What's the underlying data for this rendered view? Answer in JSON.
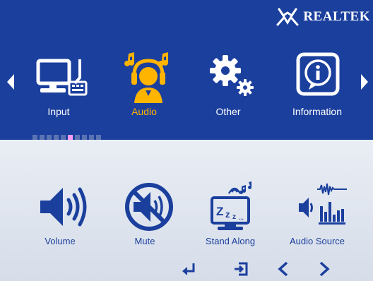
{
  "brand": {
    "name": "REALTEK"
  },
  "menu": {
    "items": [
      {
        "label": "Input",
        "icon": "computer-icon"
      },
      {
        "label": "Audio",
        "icon": "headphones-user-icon",
        "active": true
      },
      {
        "label": "Other",
        "icon": "gears-icon"
      },
      {
        "label": "Information",
        "icon": "info-icon"
      }
    ],
    "page_dots": 10,
    "active_dot": 6
  },
  "submenu": {
    "items": [
      {
        "label": "Volume",
        "icon": "speaker-icon"
      },
      {
        "label": "Mute",
        "icon": "mute-icon"
      },
      {
        "label": "Stand Along",
        "icon": "sleep-monitor-icon"
      },
      {
        "label": "Audio Source",
        "icon": "audio-source-icon"
      }
    ]
  },
  "controls": [
    "enter-icon",
    "exit-icon",
    "left-icon",
    "right-icon"
  ],
  "colors": {
    "top_bg": "#1b3f9d",
    "bottom_bg": "#dfe5ef",
    "active": "#ffb400",
    "icon_blue": "#1b3f9d"
  }
}
